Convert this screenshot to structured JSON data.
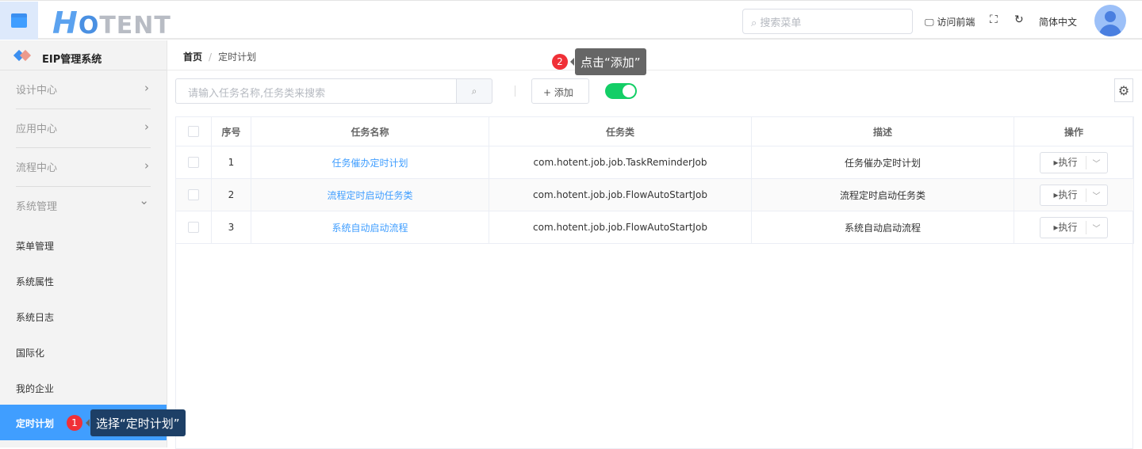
{
  "header": {
    "logo_h": "H",
    "logo_o": "O",
    "logo_rest": "TENT",
    "search_placeholder": "搜索菜单",
    "visit_front": "访问前端",
    "language": "简体中文"
  },
  "sidebar": {
    "title": "EIP管理系统",
    "groups": [
      {
        "label": "设计中心",
        "chev": "›"
      },
      {
        "label": "应用中心",
        "chev": "›"
      },
      {
        "label": "流程中心",
        "chev": "›"
      },
      {
        "label": "系统管理",
        "chev": "⌄"
      }
    ],
    "items": [
      {
        "label": "菜单管理"
      },
      {
        "label": "系统属性"
      },
      {
        "label": "系统日志"
      },
      {
        "label": "国际化"
      },
      {
        "label": "我的企业"
      },
      {
        "label": "定时计划"
      }
    ],
    "active": "定时计划"
  },
  "breadcrumb": {
    "home": "首页",
    "sep": "/",
    "current": "定时计划"
  },
  "toolbar": {
    "search_placeholder": "请输入任务名称,任务类来搜索",
    "add_label": "添加",
    "add_icon": "+",
    "toggle_on": true
  },
  "table": {
    "headers": [
      "序号",
      "任务名称",
      "任务类",
      "描述",
      "操作"
    ],
    "rows": [
      {
        "no": "1",
        "name": "任务催办定时计划",
        "cls": "com.hotent.job.job.TaskReminderJob",
        "desc": "任务催办定时计划",
        "action": "执行"
      },
      {
        "no": "2",
        "name": "流程定时启动任务类",
        "cls": "com.hotent.job.job.FlowAutoStartJob",
        "desc": "流程定时启动任务类",
        "action": "执行"
      },
      {
        "no": "3",
        "name": "系统自动启动流程",
        "cls": "com.hotent.job.job.FlowAutoStartJob",
        "desc": "系统自动启动流程",
        "action": "执行"
      }
    ]
  },
  "tips": [
    {
      "num": "1",
      "text": "选择“定时计划”"
    },
    {
      "num": "2",
      "text": "点击“添加”"
    }
  ]
}
